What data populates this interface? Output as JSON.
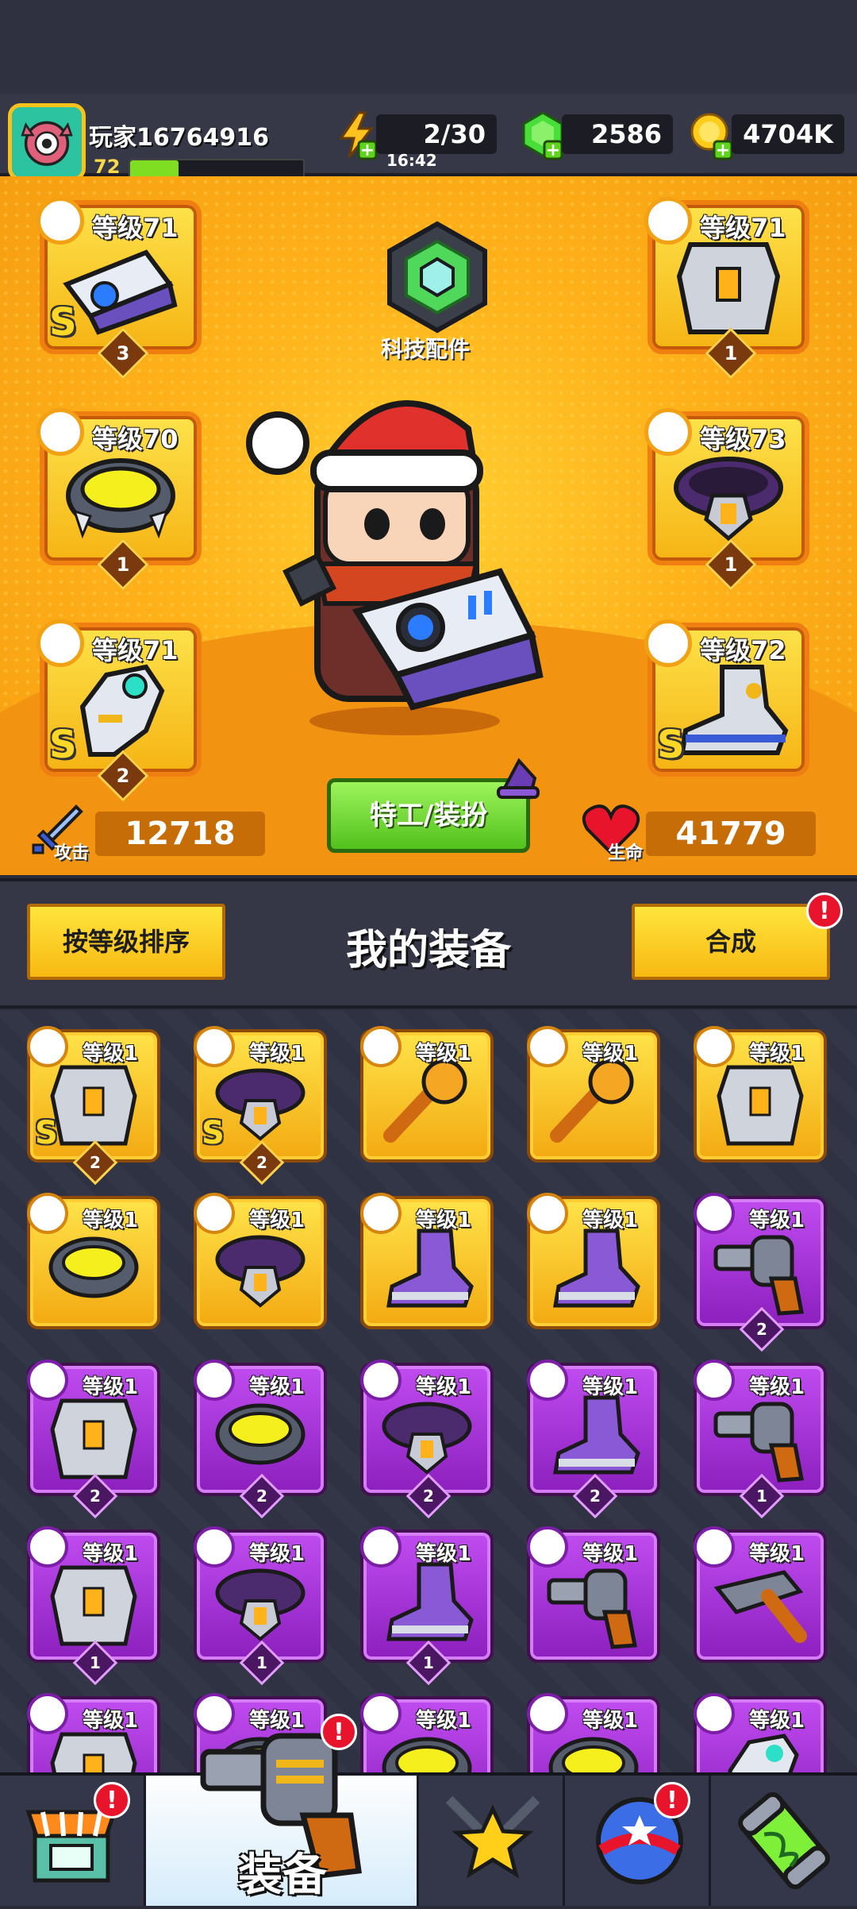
{
  "player": {
    "name": "玩家16764916",
    "level": "72",
    "xp_fraction": 0.28
  },
  "resources": {
    "energy": "2/30",
    "energy_timer": "16:42",
    "gems": "2586",
    "gold": "4704K"
  },
  "hero": {
    "tech_label": "科技配件",
    "attack_label": "攻击",
    "attack_value": "12718",
    "hp_label": "生命",
    "hp_value": "41779",
    "costume_button": "特工/装扮"
  },
  "equipped": [
    {
      "slot": "weapon",
      "level": "等级71",
      "rank": "S",
      "stars": "3",
      "icon": "gun-slot-icon"
    },
    {
      "slot": "armor",
      "level": "等级71",
      "rank": "",
      "stars": "1",
      "icon": "armor-slot-icon"
    },
    {
      "slot": "necklace",
      "level": "等级70",
      "rank": "",
      "stars": "1",
      "icon": "necklace-slot-icon"
    },
    {
      "slot": "belt",
      "level": "等级73",
      "rank": "",
      "stars": "1",
      "icon": "belt-slot-icon"
    },
    {
      "slot": "gloves",
      "level": "等级71",
      "rank": "S",
      "stars": "2",
      "icon": "glove-slot-icon"
    },
    {
      "slot": "boots",
      "level": "等级72",
      "rank": "S",
      "stars": "",
      "icon": "boot-slot-icon"
    }
  ],
  "section": {
    "sort_button": "按等级排序",
    "title": "我的装备",
    "merge_button": "合成",
    "merge_alert": "!"
  },
  "inventory": [
    {
      "level": "等级1",
      "rank": "S",
      "stars": "2",
      "rarity": "gold",
      "type": "armor"
    },
    {
      "level": "等级1",
      "rank": "S",
      "stars": "2",
      "rarity": "gold",
      "type": "belt"
    },
    {
      "level": "等级1",
      "rank": "",
      "stars": "",
      "rarity": "gold",
      "type": "weapon"
    },
    {
      "level": "等级1",
      "rank": "",
      "stars": "",
      "rarity": "gold",
      "type": "weapon"
    },
    {
      "level": "等级1",
      "rank": "",
      "stars": "",
      "rarity": "gold",
      "type": "armor"
    },
    {
      "level": "等级1",
      "rank": "",
      "stars": "",
      "rarity": "gold",
      "type": "necklace"
    },
    {
      "level": "等级1",
      "rank": "",
      "stars": "",
      "rarity": "gold",
      "type": "belt"
    },
    {
      "level": "等级1",
      "rank": "",
      "stars": "",
      "rarity": "gold",
      "type": "boots"
    },
    {
      "level": "等级1",
      "rank": "",
      "stars": "",
      "rarity": "gold",
      "type": "boots"
    },
    {
      "level": "等级1",
      "rank": "",
      "stars": "2",
      "rarity": "purple",
      "type": "weapon"
    },
    {
      "level": "等级1",
      "rank": "",
      "stars": "2",
      "rarity": "purple",
      "type": "armor"
    },
    {
      "level": "等级1",
      "rank": "",
      "stars": "2",
      "rarity": "purple",
      "type": "necklace"
    },
    {
      "level": "等级1",
      "rank": "",
      "stars": "2",
      "rarity": "purple",
      "type": "belt"
    },
    {
      "level": "等级1",
      "rank": "",
      "stars": "2",
      "rarity": "purple",
      "type": "boots"
    },
    {
      "level": "等级1",
      "rank": "",
      "stars": "1",
      "rarity": "purple",
      "type": "weapon"
    },
    {
      "level": "等级1",
      "rank": "",
      "stars": "1",
      "rarity": "purple",
      "type": "armor"
    },
    {
      "level": "等级1",
      "rank": "",
      "stars": "1",
      "rarity": "purple",
      "type": "belt"
    },
    {
      "level": "等级1",
      "rank": "",
      "stars": "1",
      "rarity": "purple",
      "type": "boots"
    },
    {
      "level": "等级1",
      "rank": "",
      "stars": "",
      "rarity": "purple",
      "type": "weapon"
    },
    {
      "level": "等级1",
      "rank": "",
      "stars": "",
      "rarity": "purple",
      "type": "shotgun"
    },
    {
      "level": "等级1",
      "rank": "",
      "stars": "",
      "rarity": "purple",
      "type": "armor"
    },
    {
      "level": "等级1",
      "rank": "",
      "stars": "",
      "rarity": "purple",
      "type": "necklace"
    },
    {
      "level": "等级1",
      "rank": "",
      "stars": "",
      "rarity": "purple",
      "type": "necklace"
    },
    {
      "level": "等级1",
      "rank": "",
      "stars": "",
      "rarity": "purple",
      "type": "necklace"
    },
    {
      "level": "等级1",
      "rank": "",
      "stars": "",
      "rarity": "purple",
      "type": "gloves"
    }
  ],
  "nav": {
    "items": [
      {
        "name": "shop",
        "icon": "shop-icon",
        "alert": "!"
      },
      {
        "name": "equipment",
        "label": "装备",
        "icon": "revolver-icon",
        "alert": "!",
        "active": true
      },
      {
        "name": "battle",
        "icon": "star-swords-icon"
      },
      {
        "name": "talent",
        "icon": "star-ball-icon",
        "alert": "!"
      },
      {
        "name": "gene",
        "icon": "dna-capsule-icon"
      }
    ]
  },
  "colors": {
    "gold_frame": "#f6b414",
    "purple_frame": "#8c1fbe",
    "accent_green": "#52c11d",
    "alert_red": "#e8142c"
  }
}
